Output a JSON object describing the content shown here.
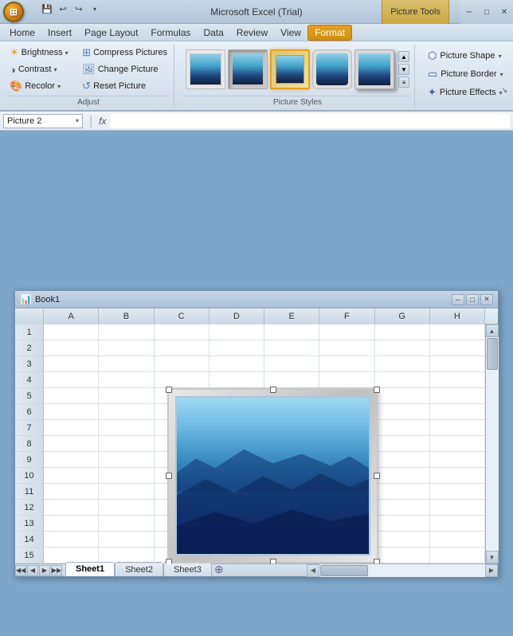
{
  "app": {
    "title": "Microsoft Excel (Trial)",
    "picture_tools": "Picture Tools"
  },
  "tabs": {
    "home": "Home",
    "insert": "Insert",
    "page_layout": "Page Layout",
    "formulas": "Formulas",
    "data": "Data",
    "review": "Review",
    "view": "View",
    "format": "Format"
  },
  "ribbon": {
    "adjust_group": {
      "label": "Adjust",
      "brightness": "Brightness",
      "contrast": "Contrast",
      "recolor": "Recolor",
      "compress": "Compress Pictures",
      "change": "Change Picture",
      "reset": "Reset Picture"
    },
    "styles_group": {
      "label": "Picture Styles"
    },
    "right_group": {
      "shape": "Picture Shape",
      "border": "Picture Border",
      "effects": "Picture Effects",
      "expand_icon": "▾"
    }
  },
  "formula_bar": {
    "name_box": "Picture 2",
    "fx_label": "fx"
  },
  "workbook": {
    "title": "Book1",
    "icon": "📊",
    "columns": [
      "A",
      "B",
      "C",
      "D",
      "E",
      "F",
      "G",
      "H"
    ],
    "rows": [
      1,
      2,
      3,
      4,
      5,
      6,
      7,
      8,
      9,
      10,
      11,
      12,
      13,
      14,
      15
    ]
  },
  "sheets": {
    "tabs": [
      "Sheet1",
      "Sheet2",
      "Sheet3"
    ],
    "active": 0
  },
  "controls": {
    "minimize": "─",
    "restore": "□",
    "close": "✕"
  }
}
